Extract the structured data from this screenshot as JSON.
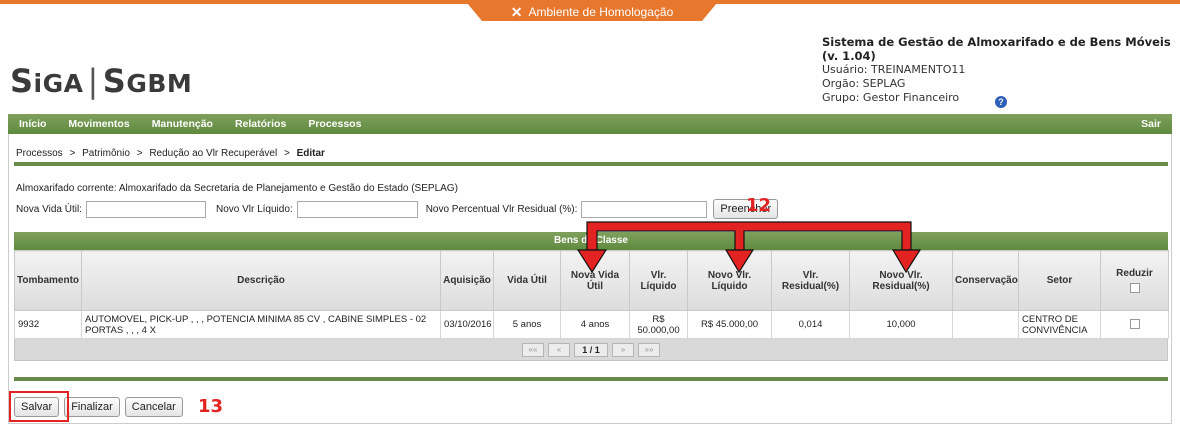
{
  "banner": {
    "environment": "Ambiente de Homologação",
    "tool_icon": "tools-icon"
  },
  "logo": {
    "s1": "S",
    "i": "i",
    "ga": "GA",
    "bar": "|",
    "s2": "S",
    "gbm": "GBM"
  },
  "system": {
    "title": "Sistema de Gestão de Almoxarifado e de Bens Móveis (v. 1.04)",
    "user": "Usuário: TREINAMENTO11",
    "org": "Orgão: SEPLAG",
    "group": "Grupo: Gestor Financeiro",
    "help_icon": "?"
  },
  "nav": {
    "items": [
      "Início",
      "Movimentos",
      "Manutenção",
      "Relatórios",
      "Processos"
    ],
    "logout": "Sair"
  },
  "breadcrumb": {
    "items": [
      "Processos",
      "Patrimônio",
      "Redução ao Vlr Recuperável"
    ],
    "current": "Editar",
    "sep": ">"
  },
  "almoxarifado": "Almoxarifado corrente: Almoxarifado da Secretaria de Planejamento e Gestão do Estado (SEPLAG)",
  "form": {
    "vida_label": "Nova Vida Útil:",
    "vida_value": "",
    "liquido_label": "Novo Vlr Líquido:",
    "liquido_value": "",
    "residual_label": "Novo Percentual Vlr Residual (%):",
    "residual_value": "",
    "fill_button": "Preencher"
  },
  "annotations": {
    "a12": "12",
    "a13": "13"
  },
  "table": {
    "title": "Bens da Classe",
    "headers": [
      "Tombamento",
      "Descrição",
      "Aquisição",
      "Vida Útil",
      "Nova Vida Útil",
      "Vlr. Líquido",
      "Novo Vlr. Líquido",
      "Vlr. Residual(%)",
      "Novo Vlr. Residual(%)",
      "Conservação",
      "Setor",
      "Reduzir"
    ],
    "rows": [
      {
        "tombamento": "9932",
        "descricao": "AUTOMOVEL, PICK-UP , , , POTENCIA MINIMA 85 CV , CABINE SIMPLES - 02 PORTAS , , , 4 X",
        "aquisicao": "03/10/2016",
        "vida": "5 anos",
        "nova_vida": "4 anos",
        "vlr_liquido": "R$ 50.000,00",
        "novo_liquido": "R$ 45.000,00",
        "vlr_residual": "0,014",
        "novo_residual": "10,000",
        "conservacao": "",
        "setor": "CENTRO DE CONVIVÊNCIA",
        "reduzir": false
      }
    ],
    "pager": {
      "first": "««",
      "prev": "«",
      "page": "1 / 1",
      "next": "»",
      "last": "»»"
    }
  },
  "actions": {
    "save": "Salvar",
    "finish": "Finalizar",
    "cancel": "Cancelar"
  },
  "colors": {
    "accent_orange": "#e8772e",
    "nav_green": "#6a8a4a",
    "annotation_red": "#e32222"
  }
}
